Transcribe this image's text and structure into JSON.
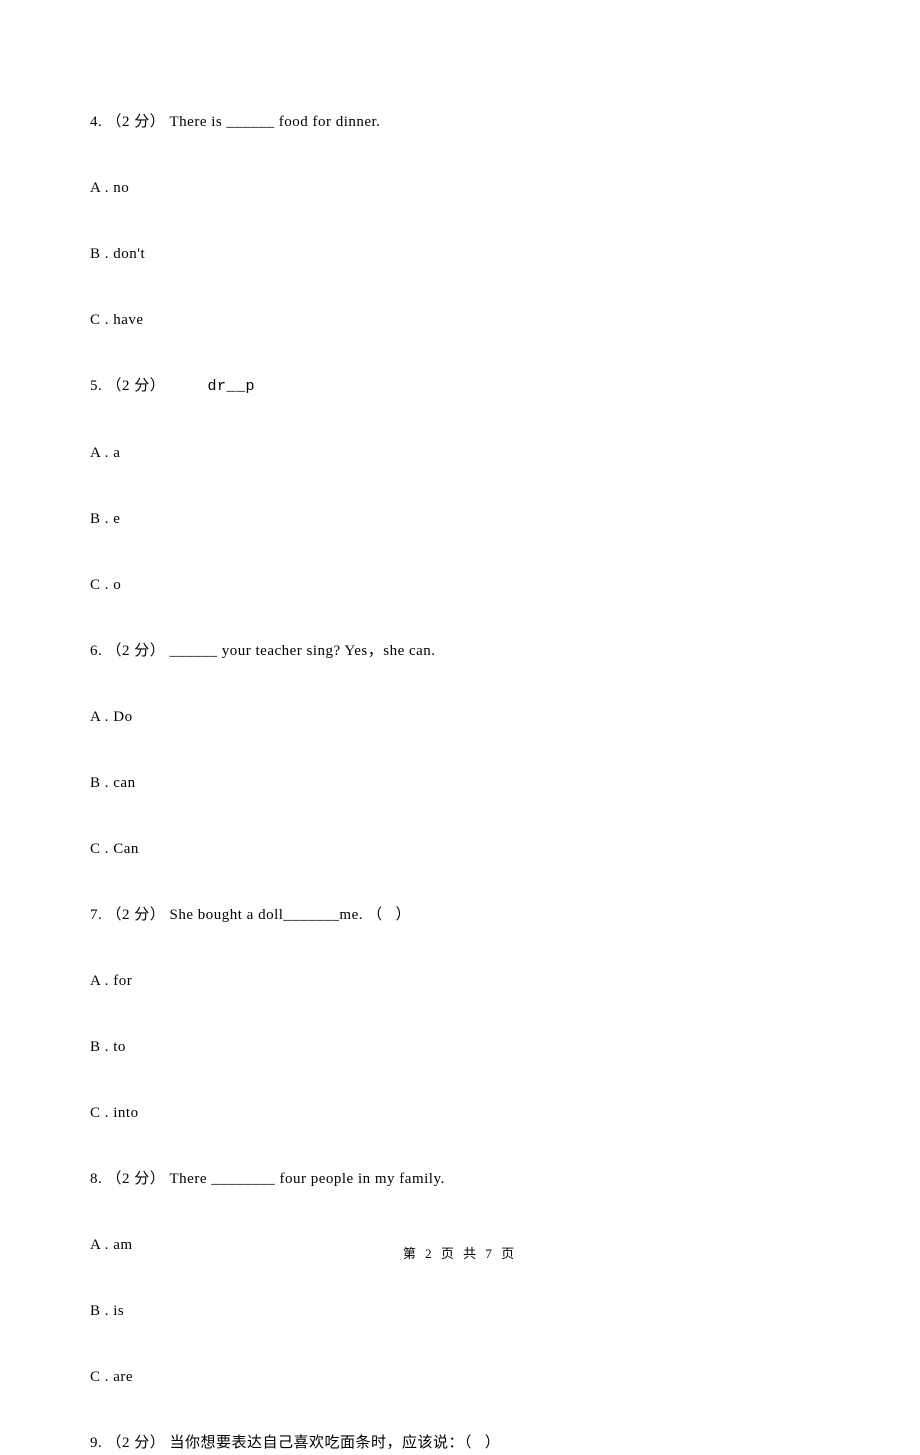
{
  "questions": [
    {
      "num": "4.",
      "pts": "（2 分）",
      "text": "There is ______ food for dinner.",
      "optA": "A . no",
      "optB": "B . don't",
      "optC": "C . have"
    },
    {
      "num": "5.",
      "pts": "（2 分）",
      "text": "    dr__p",
      "optA": "A . a",
      "optB": "B . e",
      "optC": "C . o"
    },
    {
      "num": "6.",
      "pts": "（2 分）",
      "text": "______ your teacher sing? Yes，she can.",
      "optA": "A . Do",
      "optB": "B . can",
      "optC": "C . Can"
    },
    {
      "num": "7.",
      "pts": "（2 分）",
      "text": "She bought a doll_______me. （   ）",
      "optA": "A . for",
      "optB": "B . to",
      "optC": "C . into"
    },
    {
      "num": "8.",
      "pts": "（2 分）",
      "text": "There ________ four people in my family.",
      "optA": "A . am",
      "optB": "B . is",
      "optC": "C . are"
    },
    {
      "num": "9.",
      "pts": "（2 分）",
      "text": "当你想要表达自己喜欢吃面条时，应该说：（   ）"
    }
  ],
  "footer": "第 2 页 共 7 页"
}
